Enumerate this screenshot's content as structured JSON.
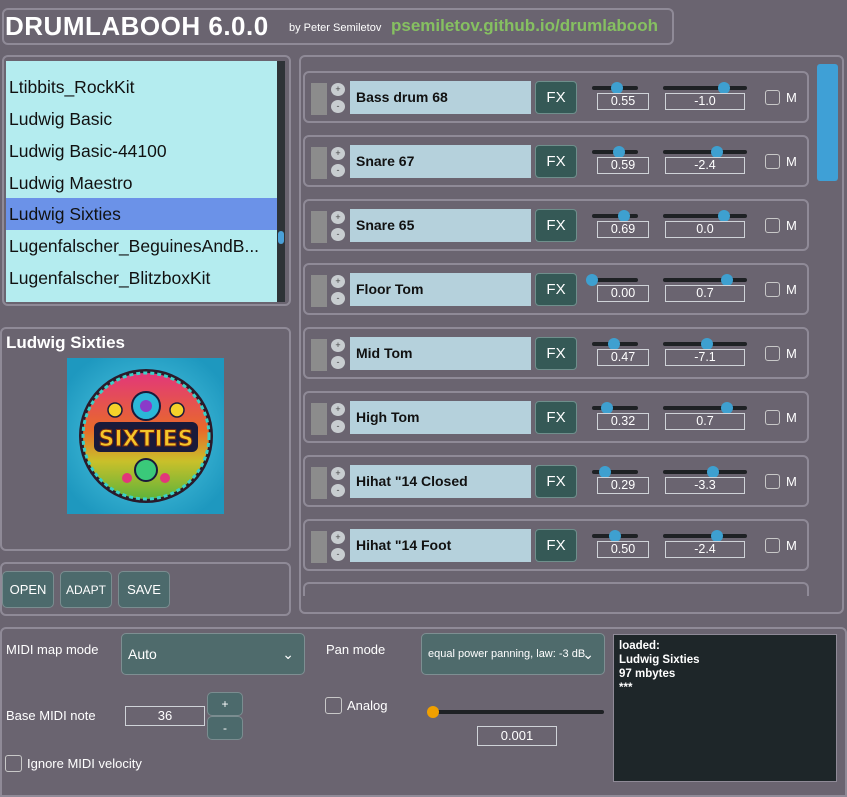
{
  "header": {
    "title": "DRUMLABOOH 6.0.0",
    "author": "by Peter Semiletov",
    "link": "psemiletov.github.io/drumlabooh"
  },
  "kits": {
    "items": [
      "Ltibbits_RockKit",
      "Ludwig Basic",
      "Ludwig Basic-44100",
      "Ludwig Maestro",
      "Ludwig Sixties",
      "Lugenfalscher_BeguinesAndB...",
      "Lugenfalscher_BlitzboxKit"
    ],
    "selected_index": 4
  },
  "kit_info": {
    "name": "Ludwig Sixties",
    "image_text": "SIXTIES"
  },
  "buttons": {
    "open": "OPEN",
    "adapt": "ADAPT",
    "save": "SAVE"
  },
  "drums": [
    {
      "name": "Bass drum 68",
      "fx": "FX",
      "gain": "0.55",
      "gain_level": 0.55,
      "pan": "-1.0",
      "pan_level": 0.73,
      "mute_label": "M"
    },
    {
      "name": "Snare 67",
      "fx": "FX",
      "gain": "0.59",
      "gain_level": 0.59,
      "pan": "-2.4",
      "pan_level": 0.64,
      "mute_label": "M"
    },
    {
      "name": "Snare 65",
      "fx": "FX",
      "gain": "0.69",
      "gain_level": 0.69,
      "pan": "0.0",
      "pan_level": 0.73,
      "mute_label": "M"
    },
    {
      "name": "Floor Tom",
      "fx": "FX",
      "gain": "0.00",
      "gain_level": 0.0,
      "pan": "0.7",
      "pan_level": 0.76,
      "mute_label": "M"
    },
    {
      "name": "Mid Tom",
      "fx": "FX",
      "gain": "0.47",
      "gain_level": 0.47,
      "pan": "-7.1",
      "pan_level": 0.52,
      "mute_label": "M"
    },
    {
      "name": "High Tom",
      "fx": "FX",
      "gain": "0.32",
      "gain_level": 0.32,
      "pan": "0.7",
      "pan_level": 0.76,
      "mute_label": "M"
    },
    {
      "name": "Hihat \"14 Closed",
      "fx": "FX",
      "gain": "0.29",
      "gain_level": 0.29,
      "pan": "-3.3",
      "pan_level": 0.6,
      "mute_label": "M"
    },
    {
      "name": "Hihat \"14 Foot",
      "fx": "FX",
      "gain": "0.50",
      "gain_level": 0.5,
      "pan": "-2.4",
      "pan_level": 0.64,
      "mute_label": "M"
    }
  ],
  "settings": {
    "midi_map_mode_label": "MIDI map mode",
    "midi_map_mode_value": "Auto",
    "pan_mode_label": "Pan mode",
    "pan_mode_value": "equal power panning, law: -3 dB",
    "base_midi_note_label": "Base MIDI note",
    "base_midi_note_value": "36",
    "plus": "+",
    "minus": "-",
    "analog_label": "Analog",
    "analog_value": "0.001",
    "analog_level": 0.0,
    "ignore_velocity_label": "Ignore MIDI velocity"
  },
  "log": {
    "lines": [
      "loaded:",
      "Ludwig Sixties",
      "97 mbytes",
      "***"
    ]
  },
  "colors": {
    "background": "#6a6470",
    "link": "#86c061",
    "list_bg": "#b4ecef",
    "selection": "#6b92e8",
    "accent": "#3ea0d0",
    "analog_knob": "#f0a000"
  }
}
